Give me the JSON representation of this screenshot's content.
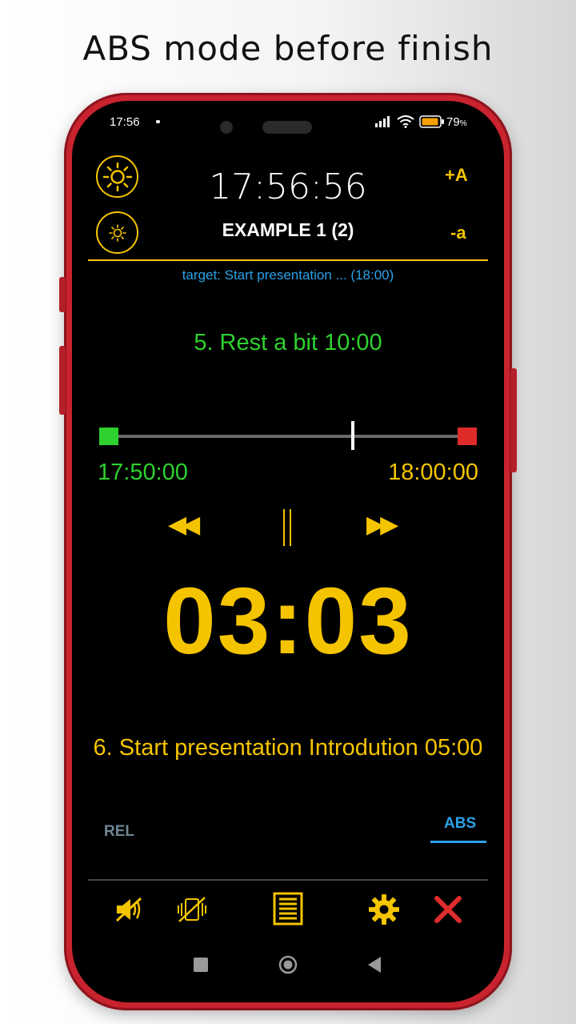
{
  "caption": "ABS mode before finish",
  "status_bar": {
    "time": "17:56",
    "battery_percent": "79",
    "battery_suffix": "%"
  },
  "header": {
    "clock": "17:56:56",
    "title": "EXAMPLE 1 (2)",
    "font_increase_label": "+A",
    "font_decrease_label": "-a"
  },
  "target_text": "target: Start presentation ... (18:00)",
  "current_item": "5. Rest a bit 10:00",
  "timeline": {
    "start_time": "17:50:00",
    "end_time": "18:00:00",
    "progress_fraction": 0.69
  },
  "controls": {
    "rewind": "◀◀",
    "pause": "||",
    "forward": "▶▶"
  },
  "countdown": "03:03",
  "next_item": "6. Start presentation Introdution 05:00",
  "mode_tabs": {
    "rel": "REL",
    "abs": "ABS",
    "selected": "ABS"
  },
  "toolbar_icons": [
    "sound-off-icon",
    "vibrate-off-icon",
    "list-icon",
    "gear-icon",
    "close-icon"
  ],
  "colors": {
    "accent": "#f5c400",
    "green": "#2ed12e",
    "red": "#e02b2b",
    "blue": "#2aa1e8",
    "frame": "#c8232e"
  }
}
